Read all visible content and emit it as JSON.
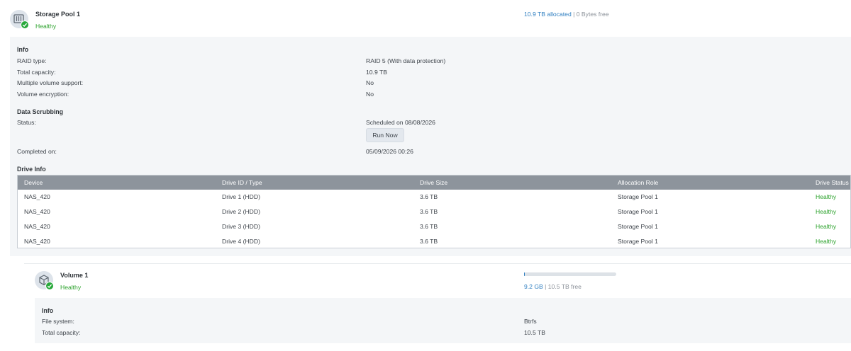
{
  "pool": {
    "name": "Storage Pool 1",
    "status": "Healthy",
    "allocated": "10.9 TB allocated",
    "separator": " | ",
    "free": "0 Bytes free",
    "info_heading": "Info",
    "info": [
      {
        "label": "RAID type:",
        "value": "RAID 5 (With data protection)"
      },
      {
        "label": "Total capacity:",
        "value": "10.9 TB"
      },
      {
        "label": "Multiple volume support:",
        "value": "No"
      },
      {
        "label": "Volume encryption:",
        "value": "No"
      }
    ],
    "scrub_heading": "Data Scrubbing",
    "scrub_status_label": "Status:",
    "scrub_status_value": "Scheduled on 08/08/2026",
    "run_now": "Run Now",
    "completed_label": "Completed on:",
    "completed_value": "05/09/2026 00:26",
    "drive_heading": "Drive Info",
    "table": {
      "columns": [
        "Device",
        "Drive ID / Type",
        "Drive Size",
        "Allocation Role",
        "Drive Status"
      ],
      "rows": [
        [
          "NAS_420",
          "Drive 1 (HDD)",
          "3.6 TB",
          "Storage Pool 1",
          "Healthy"
        ],
        [
          "NAS_420",
          "Drive 2 (HDD)",
          "3.6 TB",
          "Storage Pool 1",
          "Healthy"
        ],
        [
          "NAS_420",
          "Drive 3 (HDD)",
          "3.6 TB",
          "Storage Pool 1",
          "Healthy"
        ],
        [
          "NAS_420",
          "Drive 4 (HDD)",
          "3.6 TB",
          "Storage Pool 1",
          "Healthy"
        ]
      ]
    }
  },
  "volume": {
    "name": "Volume 1",
    "status": "Healthy",
    "used": "9.2 GB",
    "separator": " | ",
    "free": "10.5 TB free",
    "usage_fraction": 0.001,
    "info_heading": "Info",
    "info": [
      {
        "label": "File system:",
        "value": "Btrfs"
      },
      {
        "label": "Total capacity:",
        "value": "10.5 TB"
      }
    ]
  },
  "colors": {
    "healthy": "#2aa12a",
    "link": "#2f7fc1",
    "table_header": "#8d949c",
    "panel": "#f4f6f8"
  },
  "icons": {
    "pool": "storage-pool-icon",
    "volume": "volume-cube-icon",
    "status": "check-badge-icon"
  }
}
